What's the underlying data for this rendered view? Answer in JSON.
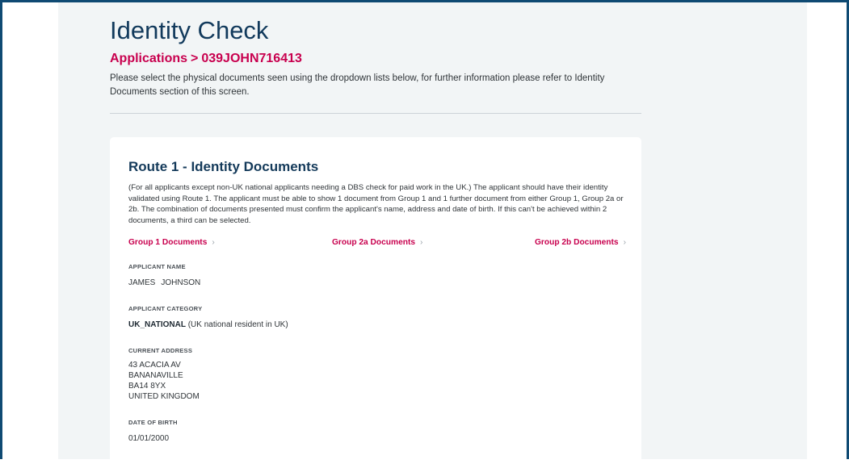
{
  "header": {
    "title": "Identity Check",
    "breadcrumb": {
      "root": "Applications",
      "separator": ">",
      "current": "039JOHN716413"
    },
    "intro": "Please select the physical documents seen using the dropdown lists below, for further information please refer to Identity Documents section of this screen."
  },
  "route": {
    "title": "Route 1 - Identity Documents",
    "description": "(For all applicants except non-UK national applicants needing a DBS check for paid work in the UK.) The applicant should have their identity validated using Route 1. The applicant must be able to show 1 document from Group 1 and 1 further document from either Group 1, Group 2a or 2b. The combination of documents presented must confirm the applicant's name, address and date of birth. If this can't be achieved within 2 documents, a third can be selected.",
    "groups": [
      {
        "label": "Group 1 Documents",
        "icon": "chevron-right-icon"
      },
      {
        "label": "Group 2a Documents",
        "icon": "chevron-right-icon"
      },
      {
        "label": "Group 2b Documents",
        "icon": "chevron-right-icon"
      }
    ]
  },
  "applicant": {
    "name_label": "APPLICANT NAME",
    "first_name": "JAMES",
    "last_name": "JOHNSON",
    "category_label": "APPLICANT CATEGORY",
    "category_code": "UK_NATIONAL",
    "category_desc": "(UK national resident in UK)",
    "address_label": "CURRENT ADDRESS",
    "address_lines": [
      "43 ACACIA AV",
      "BANANAVILLE",
      "BA14 8YX",
      "UNITED KINGDOM"
    ],
    "dob_label": "DATE OF BIRTH",
    "dob": "01/01/2000"
  },
  "colors": {
    "accent": "#c8004e",
    "heading": "#123a5c",
    "frame": "#0f4a73",
    "background": "#f2f5f6"
  }
}
